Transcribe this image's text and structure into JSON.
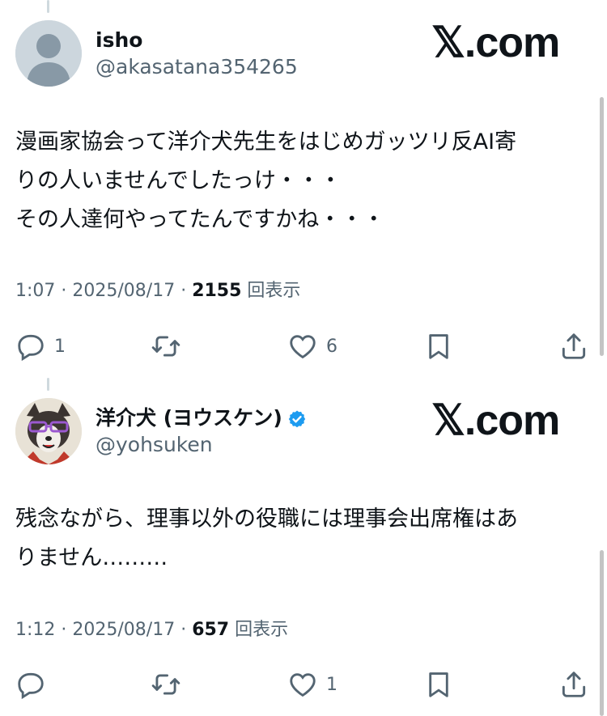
{
  "tweets": [
    {
      "display_name": "isho",
      "handle": "@akasatana354265",
      "verified": false,
      "text": "漫画家協会って洋介犬先生をはじめガッツリ反AI寄\nりの人いませんでしたっけ・・・\nその人達何やってたんですかね・・・",
      "time": "1:07",
      "date": "2025/08/17",
      "views": "2155",
      "views_label": "回表示",
      "replies": "1",
      "retweets": "",
      "likes": "6"
    },
    {
      "display_name": "洋介犬 (ヨウスケン)",
      "handle": "@yohsuken",
      "verified": true,
      "text": "残念ながら、理事以外の役職には理事会出席権はあ\nりません………",
      "time": "1:12",
      "date": "2025/08/17",
      "views": "657",
      "views_label": "回表示",
      "replies": "",
      "retweets": "",
      "likes": "1"
    }
  ],
  "watermark": "𝕏.com",
  "separator": " · ",
  "colors": {
    "secondary_text": "#536471",
    "primary_text": "#0f1419",
    "verified_blue": "#1d9bf0"
  }
}
